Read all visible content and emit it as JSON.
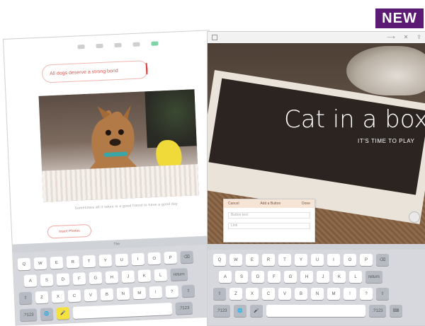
{
  "badge": {
    "label": "NEW",
    "color": "#5b1a74"
  },
  "left_app": {
    "title_text": "All dogs deserve a strong bond",
    "caption": "Sometimes all it takes is a good friend to have a good day",
    "button_label": "Insert Photos",
    "keyboard": {
      "row1": [
        "Q",
        "W",
        "E",
        "R",
        "T",
        "Y",
        "U",
        "I",
        "O",
        "P",
        "⌫"
      ],
      "row2": [
        "A",
        "S",
        "D",
        "F",
        "G",
        "H",
        "J",
        "K",
        "L",
        "return"
      ],
      "row3": [
        "⇧",
        "Z",
        "X",
        "C",
        "V",
        "B",
        "N",
        "M",
        "!",
        "?",
        "⇧"
      ],
      "row4": [
        ".?123",
        "🌐",
        "🎤",
        "",
        ".?123"
      ],
      "suggestions": [
        "",
        "The",
        ""
      ]
    }
  },
  "right_app": {
    "title": "Cat in a box",
    "subtitle": "IT'S TIME TO PLAY",
    "popup": {
      "cancel": "Cancel",
      "heading": "Add a Button",
      "done": "Done",
      "field1": "Button text",
      "field2": "Link"
    },
    "keyboard": {
      "row1": [
        "Q",
        "W",
        "E",
        "R",
        "T",
        "Y",
        "U",
        "I",
        "O",
        "P",
        "⌫"
      ],
      "row2": [
        "A",
        "S",
        "D",
        "F",
        "G",
        "H",
        "J",
        "K",
        "L",
        "return"
      ],
      "row3": [
        "⇧",
        "Z",
        "X",
        "C",
        "V",
        "B",
        "N",
        "M",
        "!",
        "?",
        "⇧"
      ],
      "row4": [
        ".?123",
        "🌐",
        "🎤",
        "",
        ".?123",
        "⌨"
      ]
    }
  }
}
